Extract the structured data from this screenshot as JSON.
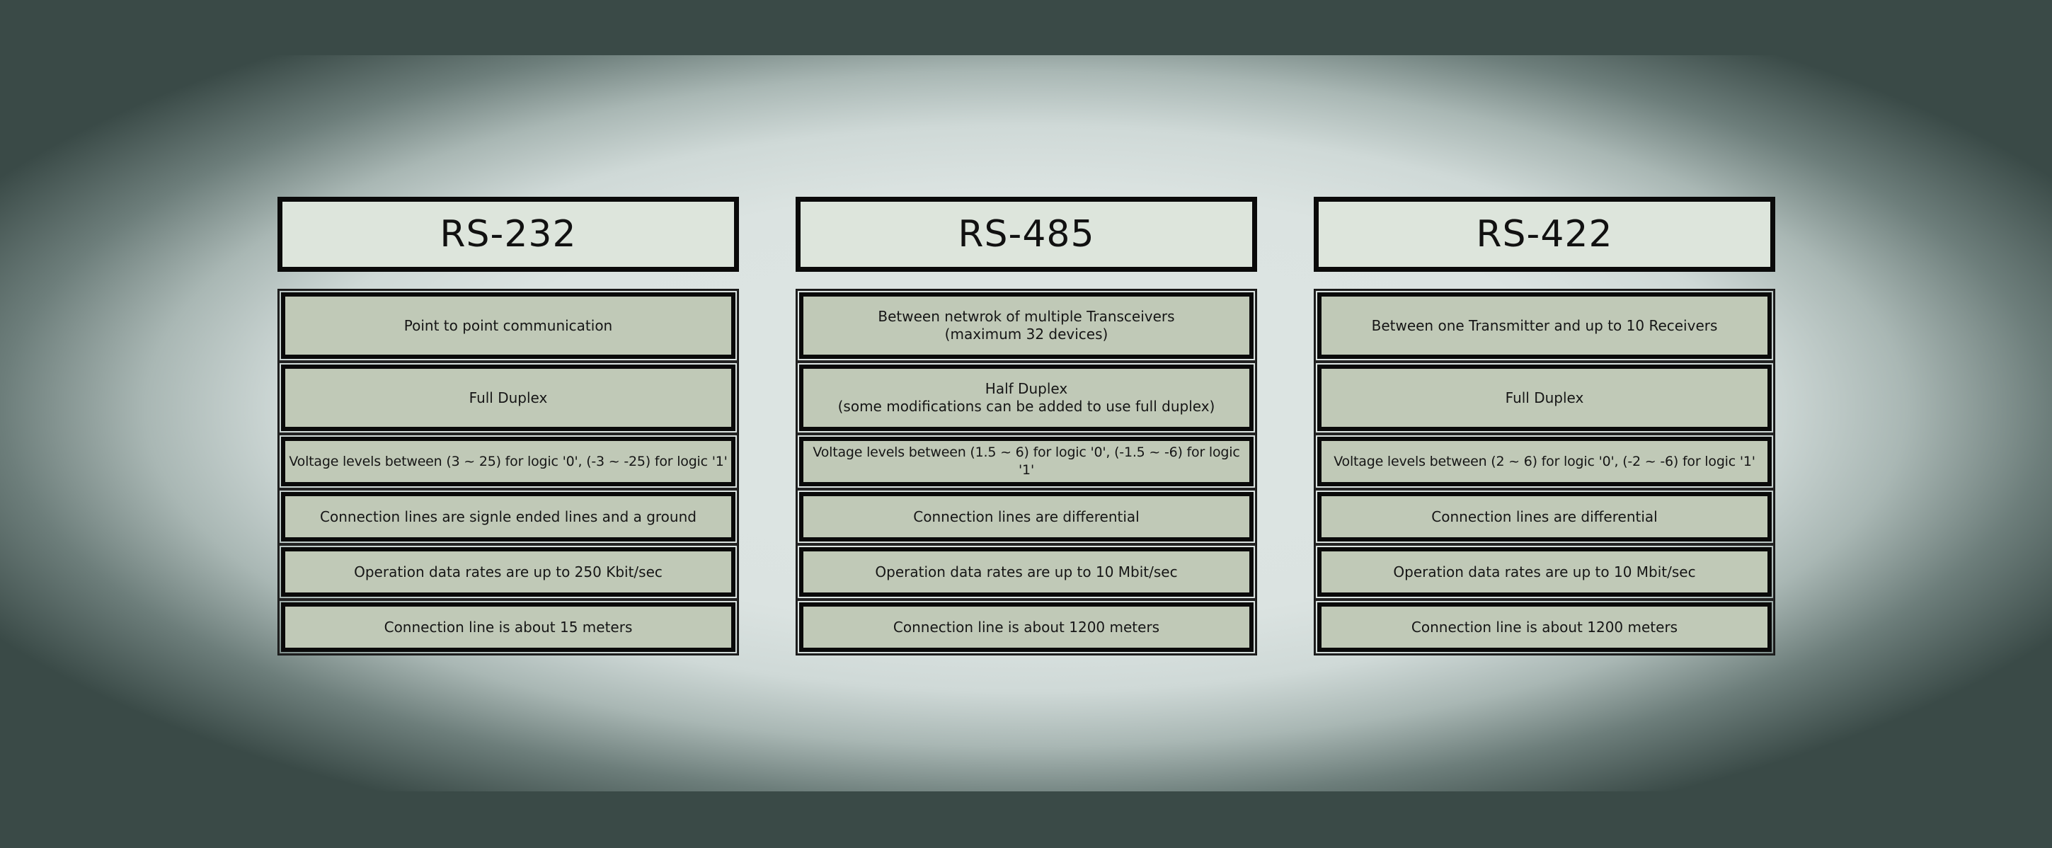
{
  "columns": [
    {
      "title": "RS-232",
      "rows": [
        "Point to point communication",
        "Full Duplex",
        "Voltage levels between (3 ~ 25) for logic '0', (-3 ~ -25) for logic '1'",
        "Connection lines are signle ended lines and a ground",
        "Operation data rates are up to 250 Kbit/sec",
        "Connection line is about 15 meters"
      ]
    },
    {
      "title": "RS-485",
      "rows": [
        "Between netwrok of multiple Transceivers\n(maximum 32 devices)",
        "Half Duplex\n(some modifications can be added to use full duplex)",
        "Voltage levels between (1.5 ~ 6) for logic '0', (-1.5 ~ -6) for logic '1'",
        "Connection lines are differential",
        "Operation data rates are up to 10 Mbit/sec",
        "Connection line is about 1200 meters"
      ]
    },
    {
      "title": "RS-422",
      "rows": [
        "Between one Transmitter and up to 10 Receivers",
        "Full Duplex",
        "Voltage levels between (2 ~ 6) for logic '0', (-2 ~ -6) for logic '1'",
        "Connection lines are differential",
        "Operation data rates are up to 10 Mbit/sec",
        "Connection line is about 1200 meters"
      ]
    }
  ]
}
